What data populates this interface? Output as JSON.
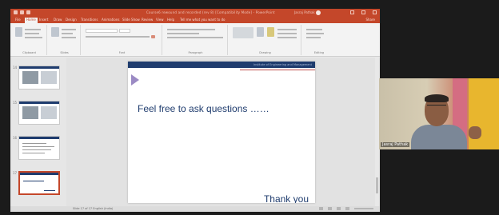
{
  "window": {
    "title": "Course6 rewound and recorded (rev 8) [Compatibility Mode] - PowerPoint",
    "account": "Jasraj Pathak"
  },
  "tabs": [
    "File",
    "Home",
    "Insert",
    "Draw",
    "Design",
    "Transitions",
    "Animations",
    "Slide Show",
    "Review",
    "View",
    "Help",
    "Tell me what you want to do"
  ],
  "share_label": "Share",
  "ribbon_groups": [
    "Clipboard",
    "Slides",
    "Font",
    "Paragraph",
    "Drawing",
    "Editing"
  ],
  "thumbnails": [
    {
      "number": "14"
    },
    {
      "number": "15"
    },
    {
      "number": "16"
    },
    {
      "number": "17"
    }
  ],
  "slide": {
    "header_text": "Institute of Engineering and Management",
    "message": "Feel free to ask questions ……",
    "closing": "Thank you"
  },
  "statusbar": {
    "left": "Slide 17 of 17  English (India)"
  },
  "webcam": {
    "participant_name": "Jasraj Pathak"
  },
  "colors": {
    "powerpoint_accent": "#c4472a",
    "slide_navy": "#1f3c6e",
    "slide_red_rule": "#c0504d",
    "arrow_purple": "#9b8ac4"
  }
}
